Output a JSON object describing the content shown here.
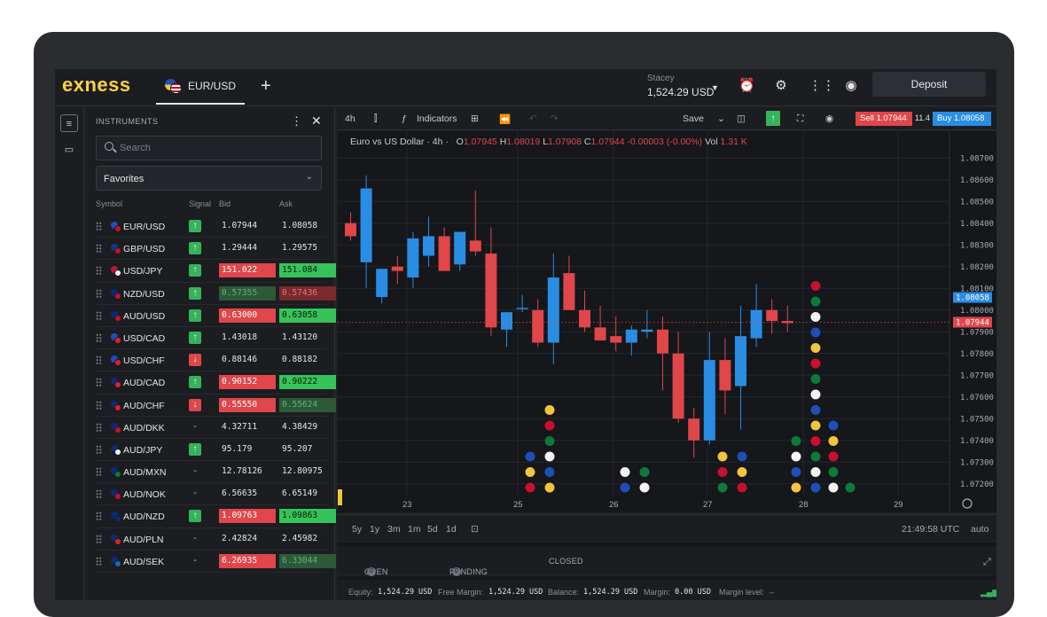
{
  "app": {
    "logo": "exness",
    "tab_label": "EUR/USD",
    "add_tab": "+",
    "account_name": "Stacey",
    "account_balance": "1,524.29 USD",
    "deposit_label": "Deposit"
  },
  "icons": [
    "alarm-clock-icon",
    "gear-icon",
    "apps-grid-icon",
    "account-circle-icon"
  ],
  "instruments": {
    "title": "INSTRUMENTS",
    "search_placeholder": "Search",
    "favorites_label": "Favorites",
    "columns": {
      "symbol": "Symbol",
      "signal": "Signal",
      "bid": "Bid",
      "ask": "Ask"
    },
    "rows": [
      {
        "symbol": "EUR/USD",
        "signal": "up",
        "bid": "1.07944",
        "ask": "1.08058",
        "bid_hl": "",
        "ask_hl": "",
        "c1": "#1e4fb8",
        "c2": "#c8102e"
      },
      {
        "symbol": "GBP/USD",
        "signal": "up",
        "bid": "1.29444",
        "ask": "1.29575",
        "bid_hl": "",
        "ask_hl": "",
        "c1": "#0a3a8c",
        "c2": "#c8102e"
      },
      {
        "symbol": "USD/JPY",
        "signal": "up",
        "bid": "151.022",
        "ask": "151.084",
        "bid_hl": "red",
        "ask_hl": "green",
        "c1": "#c8102e",
        "c2": "#f4f4f4"
      },
      {
        "symbol": "NZD/USD",
        "signal": "up",
        "bid": "0.57355",
        "ask": "0.57436",
        "bid_hl": "dimgreen",
        "ask_hl": "dimred",
        "c1": "#0a2a7a",
        "c2": "#c8102e"
      },
      {
        "symbol": "AUD/USD",
        "signal": "up",
        "bid": "0.63000",
        "ask": "0.63058",
        "bid_hl": "red",
        "ask_hl": "green",
        "c1": "#0a2a7a",
        "c2": "#c8102e"
      },
      {
        "symbol": "USD/CAD",
        "signal": "up",
        "bid": "1.43018",
        "ask": "1.43120",
        "bid_hl": "",
        "ask_hl": "",
        "c1": "#1e4fb8",
        "c2": "#e0202a"
      },
      {
        "symbol": "USD/CHF",
        "signal": "down",
        "bid": "0.88146",
        "ask": "0.88182",
        "bid_hl": "",
        "ask_hl": "",
        "c1": "#1e4fb8",
        "c2": "#e0202a"
      },
      {
        "symbol": "AUD/CAD",
        "signal": "up",
        "bid": "0.90152",
        "ask": "0.90222",
        "bid_hl": "red",
        "ask_hl": "green",
        "c1": "#0a2a7a",
        "c2": "#e0202a"
      },
      {
        "symbol": "AUD/CHF",
        "signal": "down",
        "bid": "0.55550",
        "ask": "0.55624",
        "bid_hl": "red",
        "ask_hl": "dimgreen",
        "c1": "#0a2a7a",
        "c2": "#e0202a"
      },
      {
        "symbol": "AUD/DKK",
        "signal": "none",
        "bid": "4.32711",
        "ask": "4.38429",
        "bid_hl": "",
        "ask_hl": "",
        "c1": "#0a2a7a",
        "c2": "#c8102e"
      },
      {
        "symbol": "AUD/JPY",
        "signal": "up",
        "bid": "95.179",
        "ask": "95.207",
        "bid_hl": "",
        "ask_hl": "",
        "c1": "#0a2a7a",
        "c2": "#f4f4f4"
      },
      {
        "symbol": "AUD/MXN",
        "signal": "none",
        "bid": "12.78126",
        "ask": "12.80975",
        "bid_hl": "",
        "ask_hl": "",
        "c1": "#0a2a7a",
        "c2": "#0b7a3b"
      },
      {
        "symbol": "AUD/NOK",
        "signal": "none",
        "bid": "6.56635",
        "ask": "6.65149",
        "bid_hl": "",
        "ask_hl": "",
        "c1": "#0a2a7a",
        "c2": "#c8102e"
      },
      {
        "symbol": "AUD/NZD",
        "signal": "up",
        "bid": "1.09763",
        "ask": "1.09863",
        "bid_hl": "red",
        "ask_hl": "green",
        "c1": "#0a2a7a",
        "c2": "#0a2a7a"
      },
      {
        "symbol": "AUD/PLN",
        "signal": "none",
        "bid": "2.42824",
        "ask": "2.45982",
        "bid_hl": "",
        "ask_hl": "",
        "c1": "#0a2a7a",
        "c2": "#e0202a"
      },
      {
        "symbol": "AUD/SEK",
        "signal": "none",
        "bid": "6.26935",
        "ask": "6.33044",
        "bid_hl": "red",
        "ask_hl": "dimgreen",
        "c1": "#0a2a7a",
        "c2": "#1e6ab8"
      }
    ]
  },
  "toolbar": {
    "timeframe": "4h",
    "indicators": "Indicators",
    "save": "Save",
    "sell_label": "Sell 1.07944",
    "spread": "11.4",
    "buy_label": "Buy 1.08058"
  },
  "chart": {
    "legend_title": "Euro vs US Dollar · 4h ·",
    "ohlc": {
      "o_label": "O",
      "o": "1.07945",
      "h_label": "H",
      "h": "1.08019",
      "l_label": "L",
      "l": "1.07908",
      "c_label": "C",
      "c": "1.07944",
      "chg": "-0.00003 (-0.00%)",
      "vol_label": "Vol",
      "vol": "1.31 K"
    },
    "y_ticks": [
      "1.08700",
      "1.08600",
      "1.08500",
      "1.08400",
      "1.08300",
      "1.08200",
      "1.08100",
      "1.08000",
      "1.07900",
      "1.07800",
      "1.07700",
      "1.07600",
      "1.07500",
      "1.07400",
      "1.07300",
      "1.07200"
    ],
    "x_ticks": [
      "23",
      "25",
      "26",
      "27",
      "28",
      "29"
    ],
    "ask_marker": "1.08058",
    "bid_marker": "1.07944",
    "colors": {
      "up": "#2a8de4",
      "down": "#e0464a"
    }
  },
  "chart_data": {
    "type": "candlestick",
    "title": "Euro vs US Dollar · 4h ·",
    "ylim": [
      1.0715,
      1.0875
    ],
    "x_ticks": [
      "23",
      "25",
      "26",
      "27",
      "28",
      "29"
    ],
    "ohlc": [
      [
        1.084,
        1.0845,
        1.0832,
        1.0834
      ],
      [
        1.0822,
        1.0862,
        1.081,
        1.0856
      ],
      [
        1.0806,
        1.0817,
        1.0803,
        1.0819
      ],
      [
        1.082,
        1.0825,
        1.0812,
        1.0818
      ],
      [
        1.0815,
        1.0836,
        1.081,
        1.0833
      ],
      [
        1.0825,
        1.0843,
        1.082,
        1.0834
      ],
      [
        1.0834,
        1.0838,
        1.082,
        1.0818
      ],
      [
        1.0821,
        1.0835,
        1.0818,
        1.0836
      ],
      [
        1.0832,
        1.0855,
        1.0825,
        1.0827
      ],
      [
        1.0826,
        1.0838,
        1.0788,
        1.0792
      ],
      [
        1.0791,
        1.0799,
        1.0783,
        1.0799
      ],
      [
        1.0801,
        1.0807,
        1.0799,
        1.0801
      ],
      [
        1.08,
        1.0805,
        1.0783,
        1.0785
      ],
      [
        1.0785,
        1.0826,
        1.0775,
        1.0815
      ],
      [
        1.0817,
        1.0825,
        1.0807,
        1.08
      ],
      [
        1.08,
        1.0809,
        1.079,
        1.0792
      ],
      [
        1.0792,
        1.0802,
        1.0788,
        1.0786
      ],
      [
        1.0788,
        1.0797,
        1.0781,
        1.0785
      ],
      [
        1.0785,
        1.0793,
        1.0779,
        1.0791
      ],
      [
        1.079,
        1.08,
        1.0787,
        1.0791
      ],
      [
        1.0791,
        1.0797,
        1.0763,
        1.078
      ],
      [
        1.078,
        1.079,
        1.0748,
        1.075
      ],
      [
        1.075,
        1.0755,
        1.0732,
        1.074
      ],
      [
        1.074,
        1.079,
        1.0738,
        1.0777
      ],
      [
        1.0777,
        1.0787,
        1.0752,
        1.0763
      ],
      [
        1.0765,
        1.0802,
        1.0745,
        1.0788
      ],
      [
        1.0787,
        1.0812,
        1.0783,
        1.08
      ],
      [
        1.08,
        1.0805,
        1.0789,
        1.0795
      ],
      [
        1.0795,
        1.0802,
        1.079,
        1.0794
      ]
    ]
  },
  "timeframes": [
    "5y",
    "1y",
    "3m",
    "1m",
    "5d",
    "1d"
  ],
  "clock": "21:49:58 UTC",
  "scale_mode": "auto",
  "positions": {
    "open": "OPEN",
    "open_count": "0",
    "pending": "PENDING",
    "pending_count": "0",
    "closed": "CLOSED"
  },
  "status": {
    "equity_label": "Equity:",
    "equity": "1,524.29 USD",
    "free_margin_label": "Free Margin:",
    "free_margin": "1,524.29 USD",
    "balance_label": "Balance:",
    "balance": "1,524.29 USD",
    "margin_label": "Margin:",
    "margin": "0.00 USD",
    "margin_level_label": "Margin level:",
    "margin_level": "–"
  }
}
